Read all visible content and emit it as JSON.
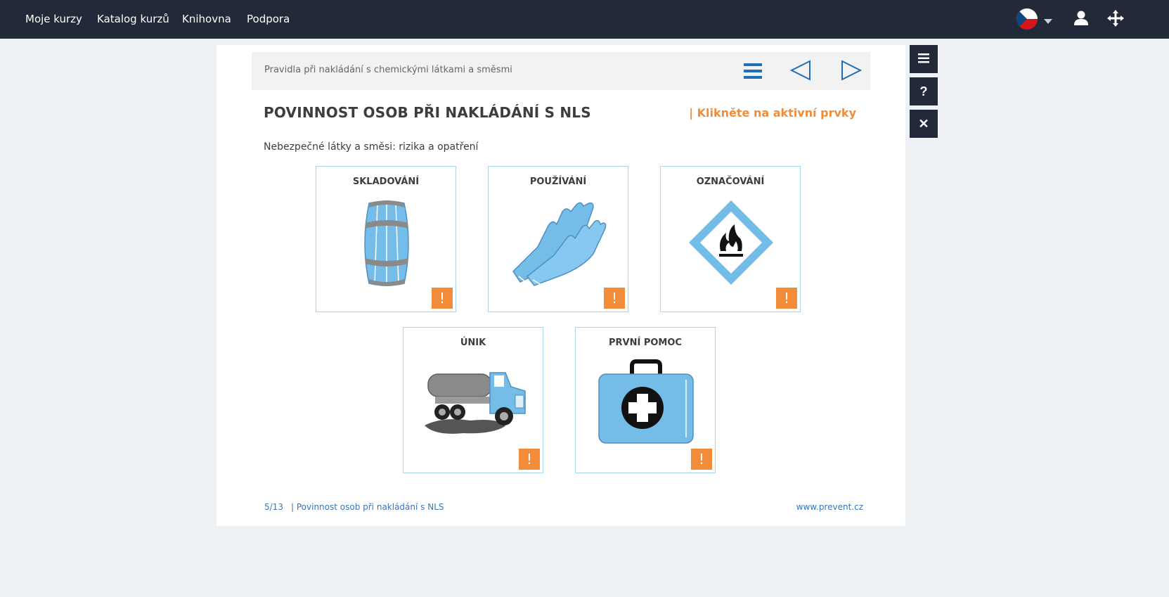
{
  "nav": {
    "items": [
      {
        "label": "Moje kurzy"
      },
      {
        "label": "Katalog kurzů"
      },
      {
        "label": "Knihovna"
      },
      {
        "label": "Podpora"
      }
    ]
  },
  "course": {
    "title": "Pravidla při nakládání s chemickými látkami a směsmi"
  },
  "page": {
    "title": "POVINNOST OSOB PŘI NAKLÁDÁNÍ S NLS",
    "hint": "| Klikněte na aktivní prvky",
    "subtitle": "Nebezpečné látky a směsi: rizika a opatření"
  },
  "tiles": [
    {
      "label": "SKLADOVÁNÍ",
      "icon": "barrel-icon"
    },
    {
      "label": "POUŽÍVÁNÍ",
      "icon": "gloves-icon"
    },
    {
      "label": "OZNAČOVÁNÍ",
      "icon": "flammable-pictogram-icon"
    },
    {
      "label": "ÚNIK",
      "icon": "tanker-truck-icon"
    },
    {
      "label": "PRVNÍ POMOC",
      "icon": "first-aid-kit-icon"
    }
  ],
  "badge": "!",
  "side_tools": {
    "help": "?",
    "close": "✕"
  },
  "footer": {
    "page_counter": "5/13",
    "section": "| Povinnost osob při nakládání s NLS",
    "site": "www.prevent.cz"
  },
  "colors": {
    "nav_bg": "#222a3a",
    "accent_orange": "#f28c38",
    "accent_blue": "#1f6fb8",
    "illustration_blue": "#74bde9"
  }
}
